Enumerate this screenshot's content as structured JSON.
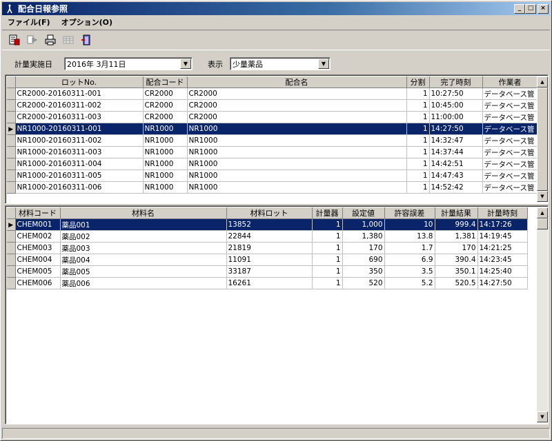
{
  "window": {
    "title": "配合日報参照",
    "minimize_label": "_",
    "maximize_label": "□",
    "close_label": "×"
  },
  "menu": {
    "file": "ファイル(F)",
    "options": "オプション(O)"
  },
  "toolbar": {
    "icons": [
      "report-icon",
      "export-icon",
      "print-icon",
      "grid-icon",
      "exit-icon"
    ]
  },
  "filter": {
    "date_label": "計量実施日",
    "date_value": "2016年  3月11日",
    "display_label": "表示",
    "display_value": "少量薬品"
  },
  "lots": {
    "columns": [
      "ロットNo.",
      "配合コード",
      "配合名",
      "分割",
      "完了時刻",
      "作業者"
    ],
    "selected_index": 3,
    "rows": [
      [
        "CR2000-20160311-001",
        "CR2000",
        "CR2000",
        "1",
        "10:27:50",
        "データベース管"
      ],
      [
        "CR2000-20160311-002",
        "CR2000",
        "CR2000",
        "1",
        "10:45:00",
        "データベース管"
      ],
      [
        "CR2000-20160311-003",
        "CR2000",
        "CR2000",
        "1",
        "11:00:00",
        "データベース管"
      ],
      [
        "NR1000-20160311-001",
        "NR1000",
        "NR1000",
        "1",
        "14:27:50",
        "データベース管"
      ],
      [
        "NR1000-20160311-002",
        "NR1000",
        "NR1000",
        "1",
        "14:32:47",
        "データベース管"
      ],
      [
        "NR1000-20160311-003",
        "NR1000",
        "NR1000",
        "1",
        "14:37:44",
        "データベース管"
      ],
      [
        "NR1000-20160311-004",
        "NR1000",
        "NR1000",
        "1",
        "14:42:51",
        "データベース管"
      ],
      [
        "NR1000-20160311-005",
        "NR1000",
        "NR1000",
        "1",
        "14:47:43",
        "データベース管"
      ],
      [
        "NR1000-20160311-006",
        "NR1000",
        "NR1000",
        "1",
        "14:52:42",
        "データベース管"
      ]
    ]
  },
  "materials": {
    "columns": [
      "材料コード",
      "材料名",
      "材料ロット",
      "計量器",
      "設定値",
      "許容誤差",
      "計量結果",
      "計量時刻"
    ],
    "rows": [
      [
        "CHEM001",
        "薬品001",
        "13852",
        "1",
        "1,000",
        "10",
        "999.4",
        "14:17:26"
      ],
      [
        "CHEM002",
        "薬品002",
        "22844",
        "1",
        "1,380",
        "13.8",
        "1,381",
        "14:19:45"
      ],
      [
        "CHEM003",
        "薬品003",
        "21819",
        "1",
        "170",
        "1.7",
        "170",
        "14:21:25"
      ],
      [
        "CHEM004",
        "薬品004",
        "11091",
        "1",
        "690",
        "6.9",
        "390.4",
        "14:23:45"
      ],
      [
        "CHEM005",
        "薬品005",
        "33187",
        "1",
        "350",
        "3.5",
        "350.1",
        "14:25:40"
      ],
      [
        "CHEM006",
        "薬品006",
        "16261",
        "1",
        "520",
        "5.2",
        "520.5",
        "14:27:50"
      ]
    ]
  }
}
